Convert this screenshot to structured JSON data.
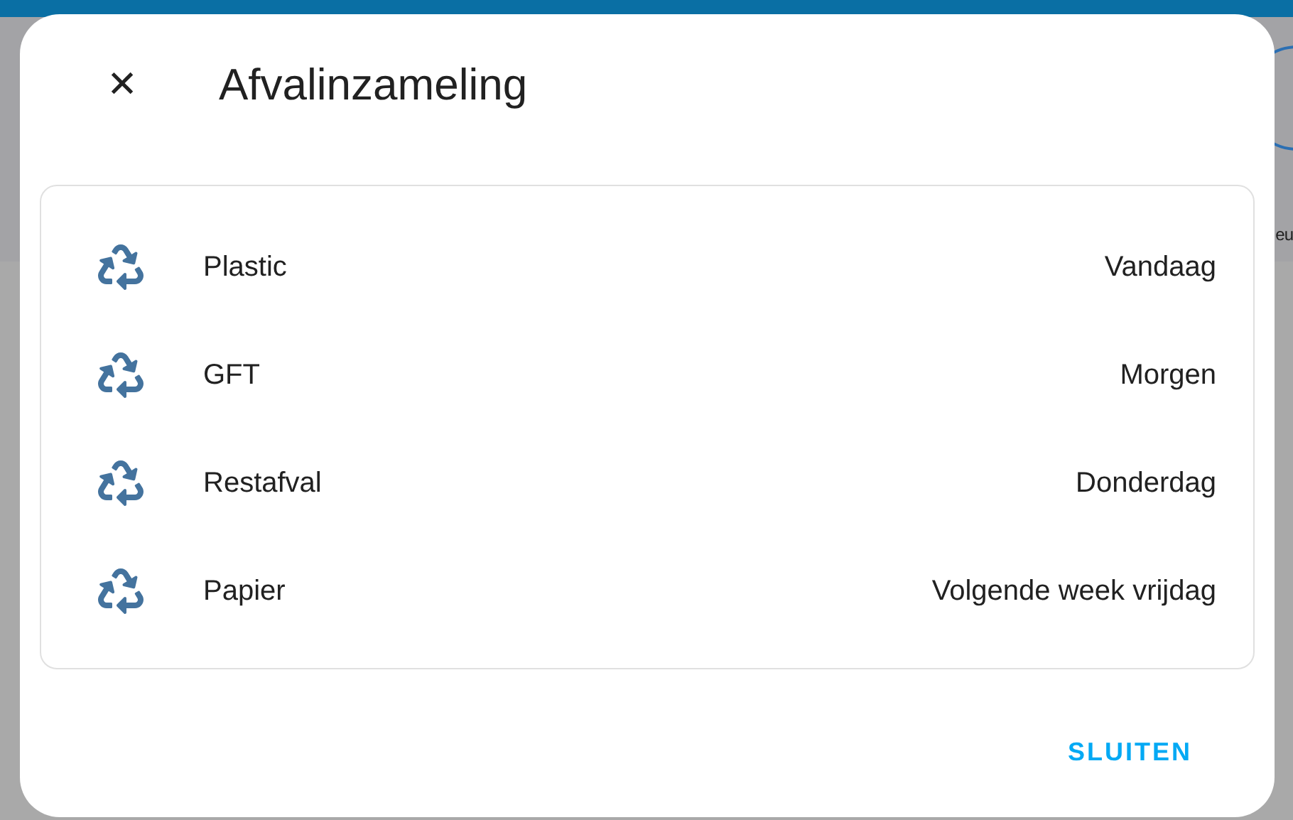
{
  "backdrop": {
    "side_label": "eu"
  },
  "dialog": {
    "title": "Afvalinzameling",
    "close_icon": "✕",
    "items": [
      {
        "name": "Plastic",
        "value": "Vandaag"
      },
      {
        "name": "GFT",
        "value": "Morgen"
      },
      {
        "name": "Restafval",
        "value": "Donderdag"
      },
      {
        "name": "Papier",
        "value": "Volgende week vrijdag"
      }
    ],
    "buttons": [
      "SLUITEN"
    ]
  }
}
